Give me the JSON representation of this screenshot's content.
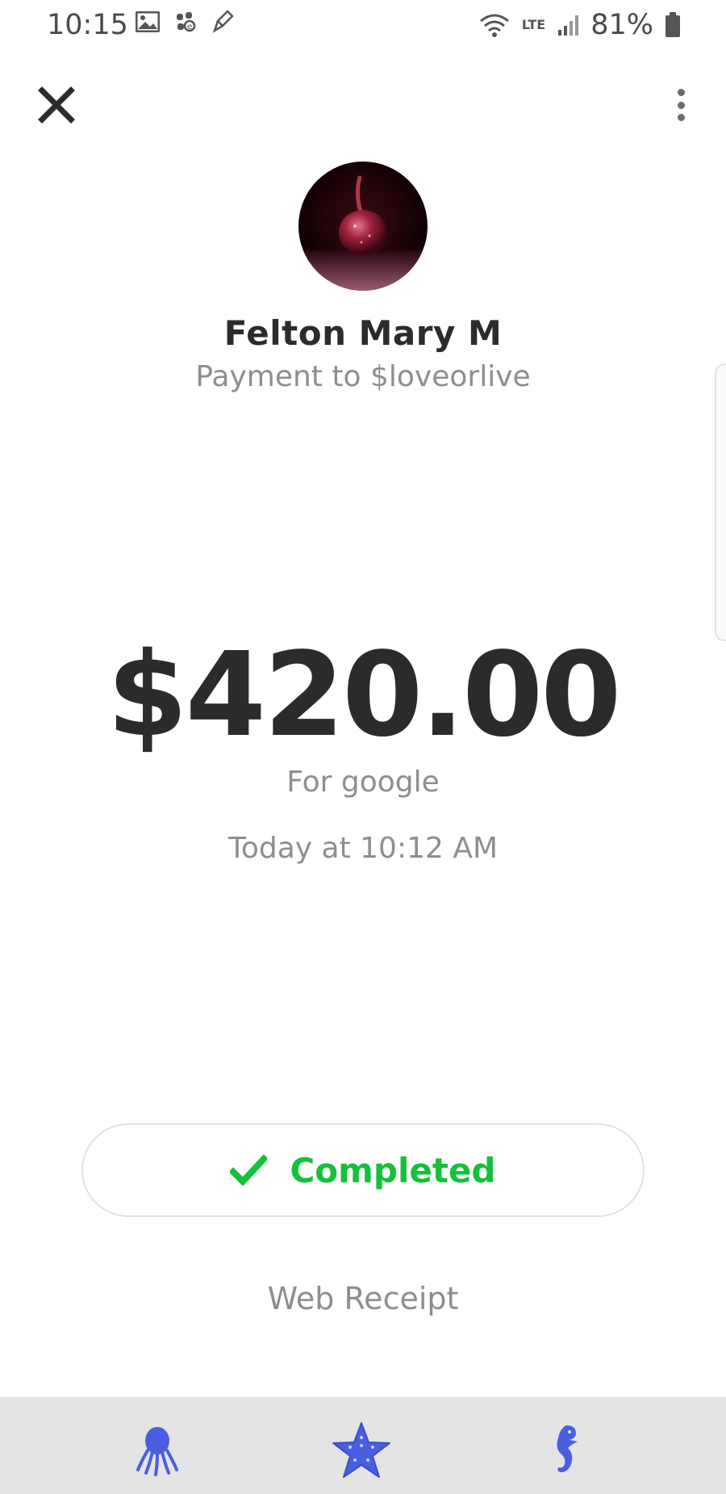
{
  "status_bar": {
    "time": "10:15",
    "network": "LTE",
    "battery_pct": "81%"
  },
  "header": {
    "close_icon": "close-icon",
    "menu_icon": "more-vert-icon"
  },
  "recipient": {
    "name": "Felton Mary M",
    "subtitle": "Payment to $loveorlive",
    "avatar": "cherry-avatar"
  },
  "payment": {
    "amount": "$420.00",
    "note": "For google",
    "datetime": "Today at 10:12 AM"
  },
  "status": {
    "label": "Completed",
    "icon": "check-icon",
    "color": "#13c13a"
  },
  "links": {
    "receipt": "Web Receipt"
  },
  "bottom_nav": {
    "items": [
      "octopus-icon",
      "starfish-icon",
      "seahorse-icon"
    ],
    "icon_color": "#4a5fe0"
  }
}
